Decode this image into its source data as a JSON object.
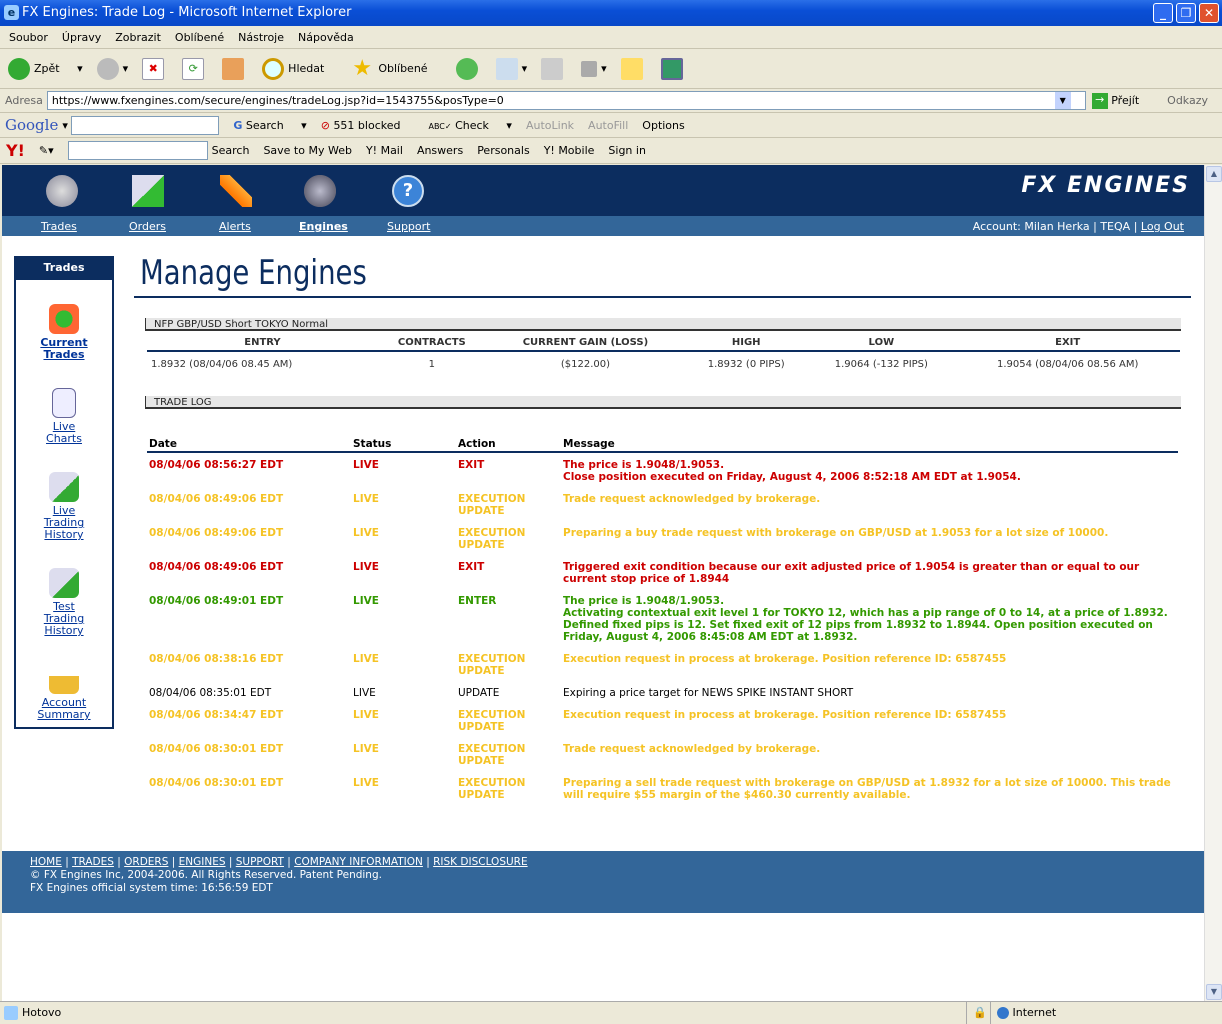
{
  "window": {
    "title": "FX Engines: Trade Log - Microsoft Internet Explorer"
  },
  "menu": [
    "Soubor",
    "Úpravy",
    "Zobrazit",
    "Oblíbené",
    "Nástroje",
    "Nápověda"
  ],
  "toolbar": {
    "back": "Zpět",
    "search": "Hledat",
    "favorites": "Oblíbené"
  },
  "address": {
    "label": "Adresa",
    "url": "https://www.fxengines.com/secure/engines/tradeLog.jsp?id=1543755&posType=0",
    "go": "Přejít",
    "links": "Odkazy"
  },
  "google_bar": {
    "brand": "Google",
    "search": "Search",
    "blocked": "551 blocked",
    "check": "Check",
    "autolink": "AutoLink",
    "autofill": "AutoFill",
    "options": "Options"
  },
  "yahoo_bar": {
    "brand": "Y!",
    "search": "Search",
    "save": "Save to My Web",
    "mail": "Y! Mail",
    "answers": "Answers",
    "personals": "Personals",
    "mobile": "Y! Mobile",
    "signin": "Sign in"
  },
  "site": {
    "logo": "FX ENGINES",
    "nav": [
      "Trades",
      "Orders",
      "Alerts",
      "Engines",
      "Support"
    ],
    "account": {
      "text": "Account: Milan Herka | TEQA |",
      "logout": "Log Out"
    },
    "sidebar": {
      "title": "Trades",
      "items": [
        [
          "Current",
          "Trades"
        ],
        [
          "Live",
          "Charts"
        ],
        [
          "Live",
          "Trading",
          "History"
        ],
        [
          "Test",
          "Trading",
          "History"
        ],
        [
          "Account",
          "Summary"
        ]
      ]
    },
    "page_title": "Manage Engines",
    "engine_name": "NFP GBP/USD Short TOKYO Normal",
    "summary": {
      "headers": [
        "ENTRY",
        "CONTRACTS",
        "CURRENT GAIN (LOSS)",
        "HIGH",
        "LOW",
        "EXIT"
      ],
      "values": [
        "1.8932 (08/04/06 08.45 AM)",
        "1",
        "($122.00)",
        "1.8932 (0 PIPS)",
        "1.9064 (-132 PIPS)",
        "1.9054 (08/04/06 08.56 AM)"
      ]
    },
    "log_title": "TRADE LOG",
    "log": {
      "headers": [
        "Date",
        "Status",
        "Action",
        "Message"
      ],
      "rows": [
        {
          "type": "red",
          "date": "08/04/06 08:56:27 EDT",
          "status": "LIVE",
          "action": "EXIT",
          "message": "The price is 1.9048/1.9053.\nClose position executed on Friday, August 4, 2006 8:52:18 AM EDT at 1.9054."
        },
        {
          "type": "yel",
          "date": "08/04/06 08:49:06 EDT",
          "status": "LIVE",
          "action": "EXECUTION UPDATE",
          "message": "Trade request acknowledged by brokerage."
        },
        {
          "type": "yel",
          "date": "08/04/06 08:49:06 EDT",
          "status": "LIVE",
          "action": "EXECUTION UPDATE",
          "message": "Preparing a buy trade request with brokerage on GBP/USD at 1.9053 for a lot size of 10000."
        },
        {
          "type": "red",
          "date": "08/04/06 08:49:06 EDT",
          "status": "LIVE",
          "action": "EXIT",
          "message": "Triggered exit condition because our exit adjusted price of 1.9054 is greater than or equal to our current stop price of 1.8944"
        },
        {
          "type": "grn",
          "date": "08/04/06 08:49:01 EDT",
          "status": "LIVE",
          "action": "ENTER",
          "message": "The price is 1.9048/1.9053.\nActivating contextual exit level 1 for TOKYO 12, which has a pip range of 0 to 14, at a price of 1.8932.\nDefined fixed pips is 12. Set fixed exit of 12 pips from 1.8932 to 1.8944. Open position executed on Friday, August 4, 2006 8:45:08 AM EDT at 1.8932."
        },
        {
          "type": "yel",
          "date": "08/04/06 08:38:16 EDT",
          "status": "LIVE",
          "action": "EXECUTION UPDATE",
          "message": "Execution request in process at brokerage. Position reference ID: 6587455"
        },
        {
          "type": "blk",
          "date": "08/04/06 08:35:01 EDT",
          "status": "LIVE",
          "action": "UPDATE",
          "message": "Expiring a price target for NEWS SPIKE INSTANT SHORT"
        },
        {
          "type": "yel",
          "date": "08/04/06 08:34:47 EDT",
          "status": "LIVE",
          "action": "EXECUTION UPDATE",
          "message": "Execution request in process at brokerage. Position reference ID: 6587455"
        },
        {
          "type": "yel",
          "date": "08/04/06 08:30:01 EDT",
          "status": "LIVE",
          "action": "EXECUTION UPDATE",
          "message": "Trade request acknowledged by brokerage."
        },
        {
          "type": "yel",
          "date": "08/04/06 08:30:01 EDT",
          "status": "LIVE",
          "action": "EXECUTION UPDATE",
          "message": "Preparing a sell trade request with brokerage on GBP/USD at 1.8932 for a lot size of 10000. This trade will require $55 margin of the $460.30 currently available."
        }
      ]
    },
    "footer": {
      "links": [
        "HOME",
        "TRADES",
        "ORDERS",
        "ENGINES",
        "SUPPORT",
        "COMPANY INFORMATION",
        "RISK DISCLOSURE"
      ],
      "copyright": "© FX Engines Inc, 2004-2006. All Rights Reserved. Patent Pending.",
      "system_time": "FX Engines official system time: 16:56:59 EDT"
    }
  },
  "status": {
    "text": "Hotovo",
    "zone": "Internet"
  },
  "colors": {
    "navy": "#0c2d5f",
    "subnav": "#336699",
    "exit": "#cc0000",
    "execution": "#f5c325",
    "enter": "#339900"
  }
}
